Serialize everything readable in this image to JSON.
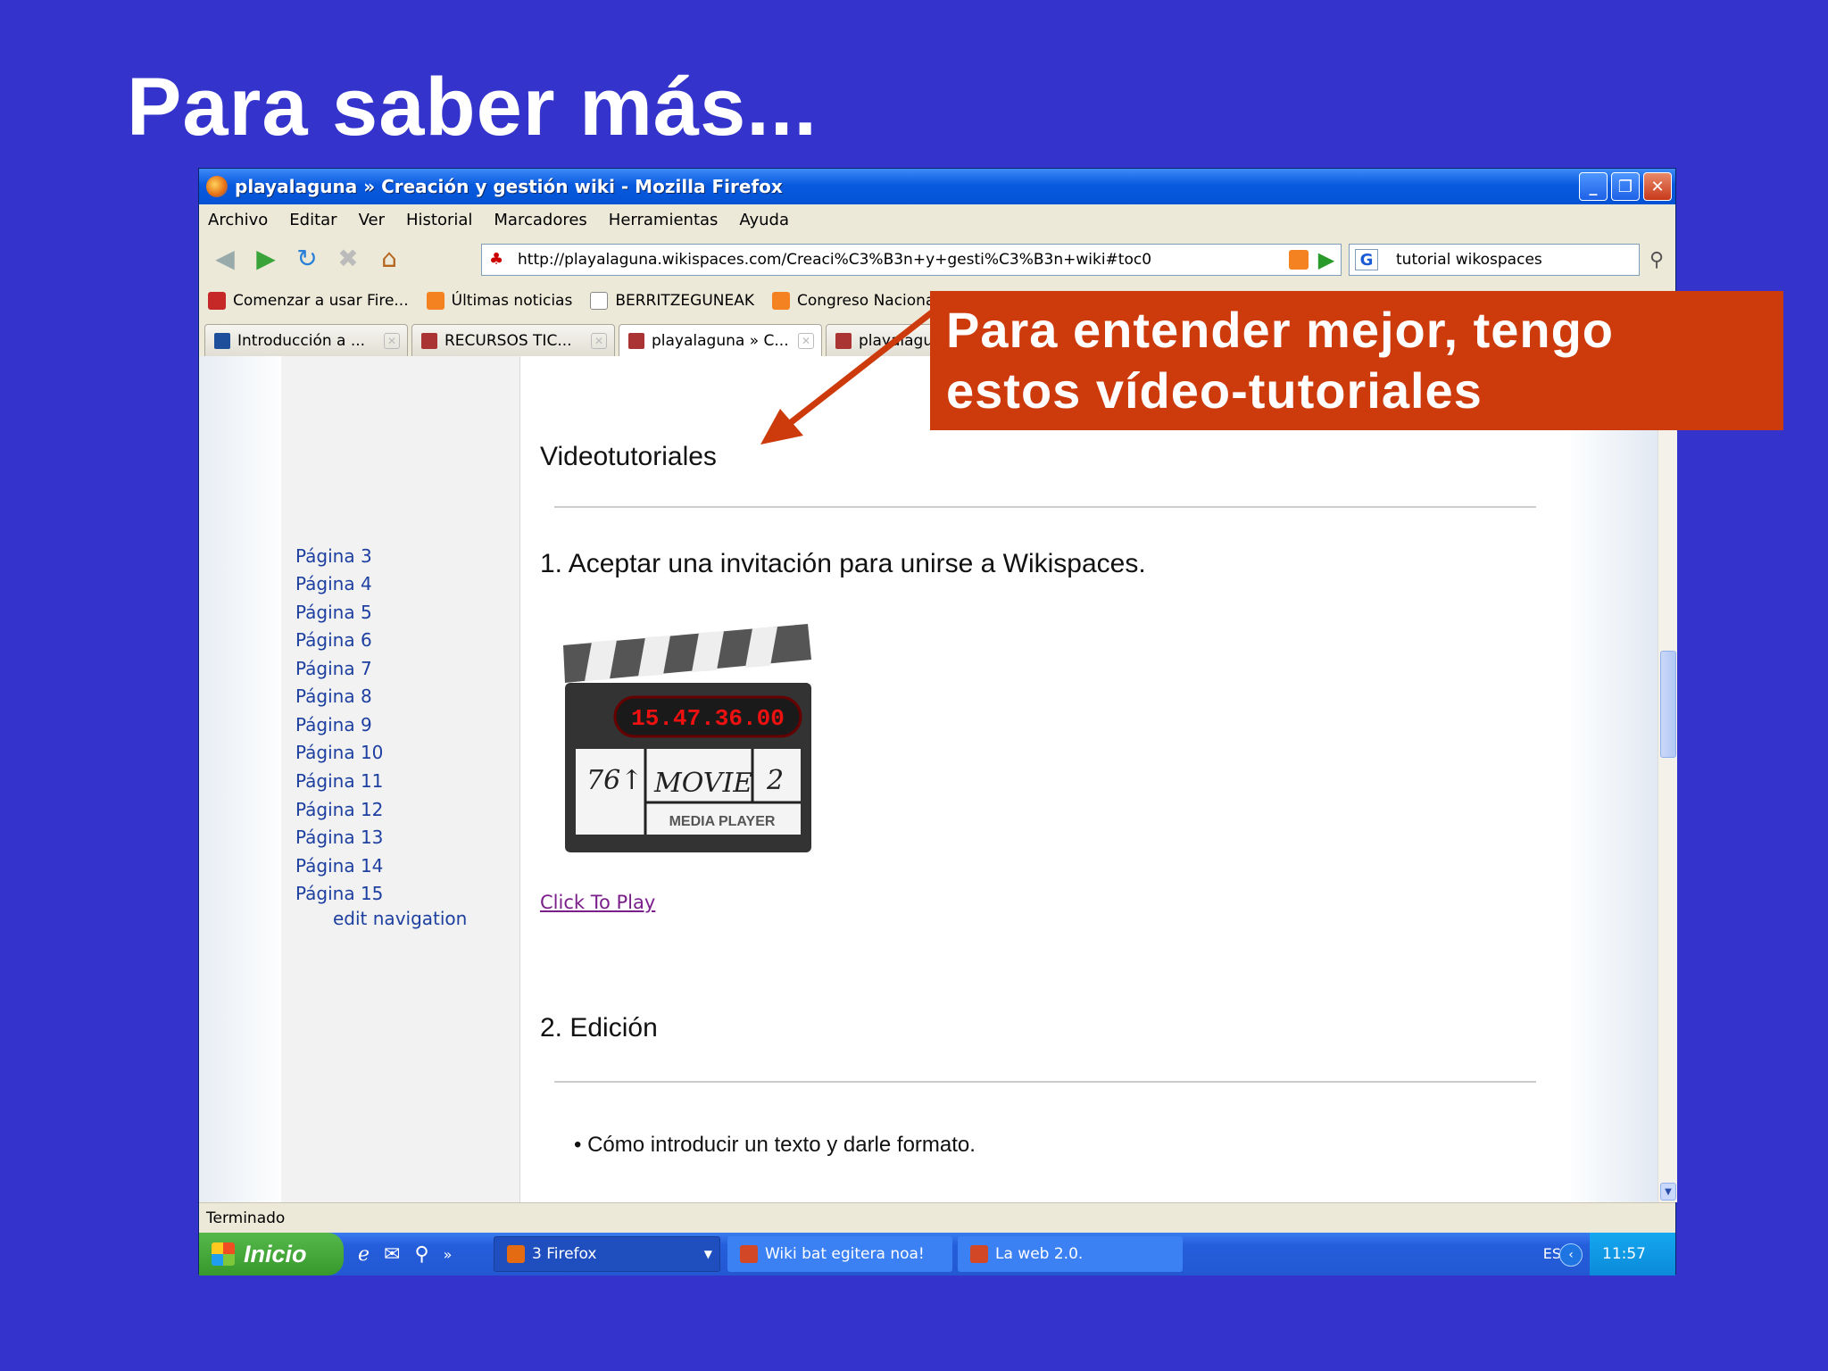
{
  "slide": {
    "title": "Para saber más..."
  },
  "window": {
    "title": "playalaguna » Creación y gestión wiki - Mozilla Firefox"
  },
  "menu": {
    "items": [
      "Archivo",
      "Editar",
      "Ver",
      "Historial",
      "Marcadores",
      "Herramientas",
      "Ayuda"
    ]
  },
  "nav": {
    "url": "http://playalaguna.wikispaces.com/Creaci%C3%B3n+y+gesti%C3%B3n+wiki#toc0",
    "search_value": "tutorial wikospaces"
  },
  "bookmarks": [
    "Comenzar a usar Fire...",
    "Últimas noticias",
    "BERRITZEGUNEAK",
    "Congreso Nacional In..."
  ],
  "tabs": [
    "Introducción a ...",
    "RECURSOS TIC...",
    "playalaguna » C...",
    "playalagu"
  ],
  "sidebar": {
    "pages": [
      "Página 3",
      "Página 4",
      "Página 5",
      "Página 6",
      "Página 7",
      "Página 8",
      "Página 9",
      "Página 10",
      "Página 11",
      "Página 12",
      "Página 13",
      "Página 14",
      "Página 15"
    ],
    "edit_navigation": "edit navigation"
  },
  "main": {
    "heading": "Videotutoriales",
    "section1": "1. Aceptar una invitación para unirse a Wikispaces.",
    "video": {
      "timecode": "15.47.36.00",
      "slate_left": "76↑",
      "slate_mid": "MOVIE",
      "slate_right": "2",
      "slate_sub": "MEDIA PLAYER"
    },
    "click_to_play": "Click To Play",
    "section2": "2. Edición",
    "bullet": "Cómo introducir un texto y darle formato."
  },
  "status": "Terminado",
  "taskbar": {
    "start": "Inicio",
    "tasks": [
      "3 Firefox",
      "Wiki bat egitera noa!",
      "La web 2.0."
    ],
    "lang": "ES",
    "clock": "11:57"
  },
  "callout": {
    "line1": "Para entender mejor, tengo",
    "line2": "estos vídeo-tutoriales"
  },
  "colors": {
    "background": "#3434cc",
    "callout": "#cd3a0b",
    "link": "#1d3fa0"
  }
}
